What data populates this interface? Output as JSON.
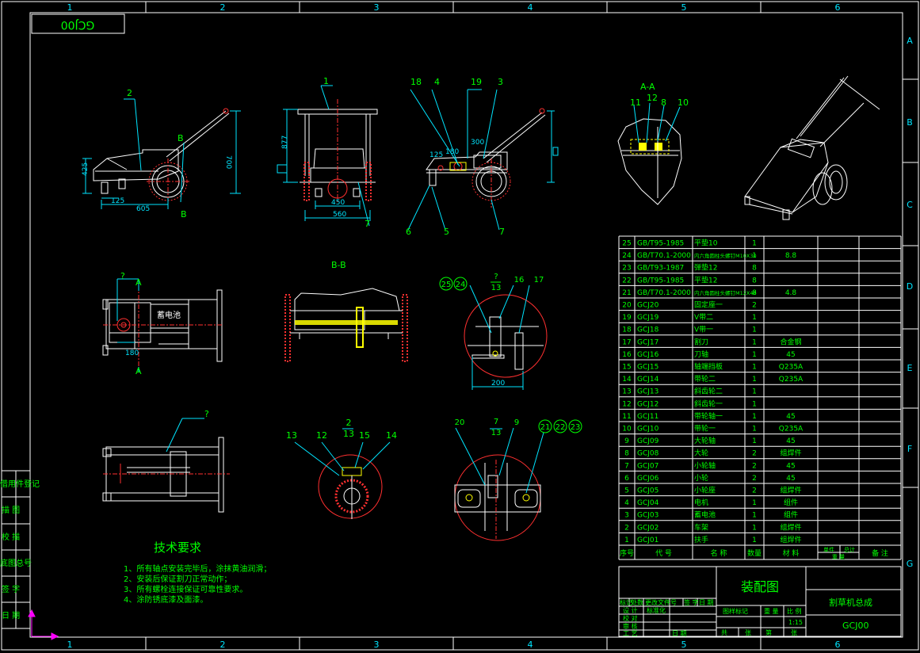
{
  "drawing_code_box": "GCJ00",
  "zone_columns": [
    "1",
    "2",
    "3",
    "4",
    "5",
    "6"
  ],
  "zone_rows": [
    "A",
    "B",
    "C",
    "D",
    "E",
    "F",
    "G"
  ],
  "section_labels": {
    "aa": "A-A",
    "bb": "B-B"
  },
  "left_strip": [
    "借用件登记",
    "描 图",
    "校 描",
    "底图总号",
    "签 字",
    "日 期"
  ],
  "view_front": {
    "balloons": [
      "2"
    ],
    "dims": [
      "425",
      "125",
      "605",
      "700"
    ],
    "markers": [
      "B",
      "B"
    ]
  },
  "view_side": {
    "balloons": [
      "1",
      "7"
    ],
    "dims": [
      "877",
      "450",
      "560"
    ]
  },
  "view_rear": {
    "balloons": [
      "18",
      "4",
      "19",
      "3",
      "6",
      "5",
      "7"
    ],
    "dims": [
      "125",
      "180",
      "300"
    ]
  },
  "view_aa": {
    "balloons": [
      "11",
      "12",
      "8",
      "10"
    ]
  },
  "view_top": {
    "balloons": [
      "?"
    ],
    "dims": [
      "180"
    ],
    "markers": [
      "A",
      "A"
    ],
    "battery_label": "蓄电池"
  },
  "view_detail_a": {
    "balloons": [
      "25",
      "24",
      "16",
      "17"
    ],
    "scale": [
      "?",
      "13"
    ],
    "dims": [
      "200"
    ]
  },
  "view_bottom": {
    "balloons": [
      "?"
    ]
  },
  "view_detail_b": {
    "balloons": [
      "13",
      "12",
      "15",
      "14"
    ],
    "scale": [
      "2",
      "13"
    ]
  },
  "view_detail_c": {
    "balloons": [
      "20",
      "9",
      "21",
      "22",
      "23"
    ],
    "scale": [
      "7",
      "13"
    ]
  },
  "tech_requirements": {
    "title": "技术要求",
    "items": [
      "1、所有轴点安装完毕后，涂抹黄油润滑；",
      "2、安装后保证割刀正常动作；",
      "3、所有螺栓连接保证可靠性要求。",
      "4、涂防锈底漆及面漆。"
    ]
  },
  "bom_header": [
    "序号",
    "代 号",
    "名 称",
    "数量",
    "材 料",
    "单件",
    "总计",
    "备 注",
    "重 量"
  ],
  "bom_rows": [
    {
      "no": "25",
      "code": "GB/T95-1985",
      "name": "平垫10",
      "qty": "1",
      "mat": "",
      "note": ""
    },
    {
      "no": "24",
      "code": "GB/T70.1-2000",
      "name": "内六角圆柱头螺钉M10X30",
      "qty": "1",
      "mat": "8.8",
      "note": ""
    },
    {
      "no": "23",
      "code": "GB/T93-1987",
      "name": "弹垫12",
      "qty": "8",
      "mat": "",
      "note": ""
    },
    {
      "no": "22",
      "code": "GB/T95-1985",
      "name": "平垫12",
      "qty": "8",
      "mat": "",
      "note": ""
    },
    {
      "no": "21",
      "code": "GB/T70.1-2000",
      "name": "内六角圆柱头螺钉M12X48",
      "qty": "8",
      "mat": "4.8",
      "note": ""
    },
    {
      "no": "20",
      "code": "GCJ20",
      "name": "固定座一",
      "qty": "2",
      "mat": "",
      "note": ""
    },
    {
      "no": "19",
      "code": "GCJ19",
      "name": "V带二",
      "qty": "1",
      "mat": "",
      "note": ""
    },
    {
      "no": "18",
      "code": "GCJ18",
      "name": "V带一",
      "qty": "1",
      "mat": "",
      "note": ""
    },
    {
      "no": "17",
      "code": "GCJ17",
      "name": "割刀",
      "qty": "1",
      "mat": "合金钢",
      "note": ""
    },
    {
      "no": "16",
      "code": "GCJ16",
      "name": "刀轴",
      "qty": "1",
      "mat": "45",
      "note": ""
    },
    {
      "no": "15",
      "code": "GCJ15",
      "name": "轴端挡板",
      "qty": "1",
      "mat": "Q235A",
      "note": ""
    },
    {
      "no": "14",
      "code": "GCJ14",
      "name": "带轮二",
      "qty": "1",
      "mat": "Q235A",
      "note": ""
    },
    {
      "no": "13",
      "code": "GCJ13",
      "name": "斜齿轮二",
      "qty": "1",
      "mat": "",
      "note": ""
    },
    {
      "no": "12",
      "code": "GCJ12",
      "name": "斜齿轮一",
      "qty": "1",
      "mat": "",
      "note": ""
    },
    {
      "no": "11",
      "code": "GCJ11",
      "name": "带轮轴一",
      "qty": "1",
      "mat": "45",
      "note": ""
    },
    {
      "no": "10",
      "code": "GCJ10",
      "name": "带轮一",
      "qty": "1",
      "mat": "Q235A",
      "note": ""
    },
    {
      "no": "9",
      "code": "GCJ09",
      "name": "大轮轴",
      "qty": "1",
      "mat": "45",
      "note": ""
    },
    {
      "no": "8",
      "code": "GCJ08",
      "name": "大轮",
      "qty": "2",
      "mat": "组焊件",
      "note": ""
    },
    {
      "no": "7",
      "code": "GCJ07",
      "name": "小轮轴",
      "qty": "2",
      "mat": "45",
      "note": ""
    },
    {
      "no": "6",
      "code": "GCJ06",
      "name": "小轮",
      "qty": "2",
      "mat": "45",
      "note": ""
    },
    {
      "no": "5",
      "code": "GCJ05",
      "name": "小轮座",
      "qty": "2",
      "mat": "组焊件",
      "note": ""
    },
    {
      "no": "4",
      "code": "GCJ04",
      "name": "电机",
      "qty": "1",
      "mat": "组件",
      "note": ""
    },
    {
      "no": "3",
      "code": "GCJ03",
      "name": "蓄电池",
      "qty": "1",
      "mat": "组件",
      "note": ""
    },
    {
      "no": "2",
      "code": "GCJ02",
      "name": "车架",
      "qty": "1",
      "mat": "组焊件",
      "note": ""
    },
    {
      "no": "1",
      "code": "GCJ01",
      "name": "扶手",
      "qty": "1",
      "mat": "组焊件",
      "note": ""
    }
  ],
  "title_block": {
    "drawing_type": "装配图",
    "product_name": "割草机总成",
    "drawing_no": "GCJ00",
    "scale": "1:15",
    "row1": [
      "标记",
      "处数",
      "更改文件号",
      "签 字",
      "日 期"
    ],
    "row2": [
      "设 计",
      "标准化"
    ],
    "row3": [
      "校 对"
    ],
    "row4": [
      "审 核"
    ],
    "row5": [
      "工 艺",
      "日 期"
    ],
    "stage_labels": [
      "图样标记",
      "重 量",
      "比 例"
    ],
    "sheet_labels": [
      "共",
      "张",
      "第",
      "张"
    ]
  },
  "colors": {
    "line": "#ffffff",
    "green": "#00ff00",
    "cyan": "#00e5ff",
    "red": "#ff3030",
    "yellow": "#ffff00",
    "magenta": "#ff00ff"
  }
}
